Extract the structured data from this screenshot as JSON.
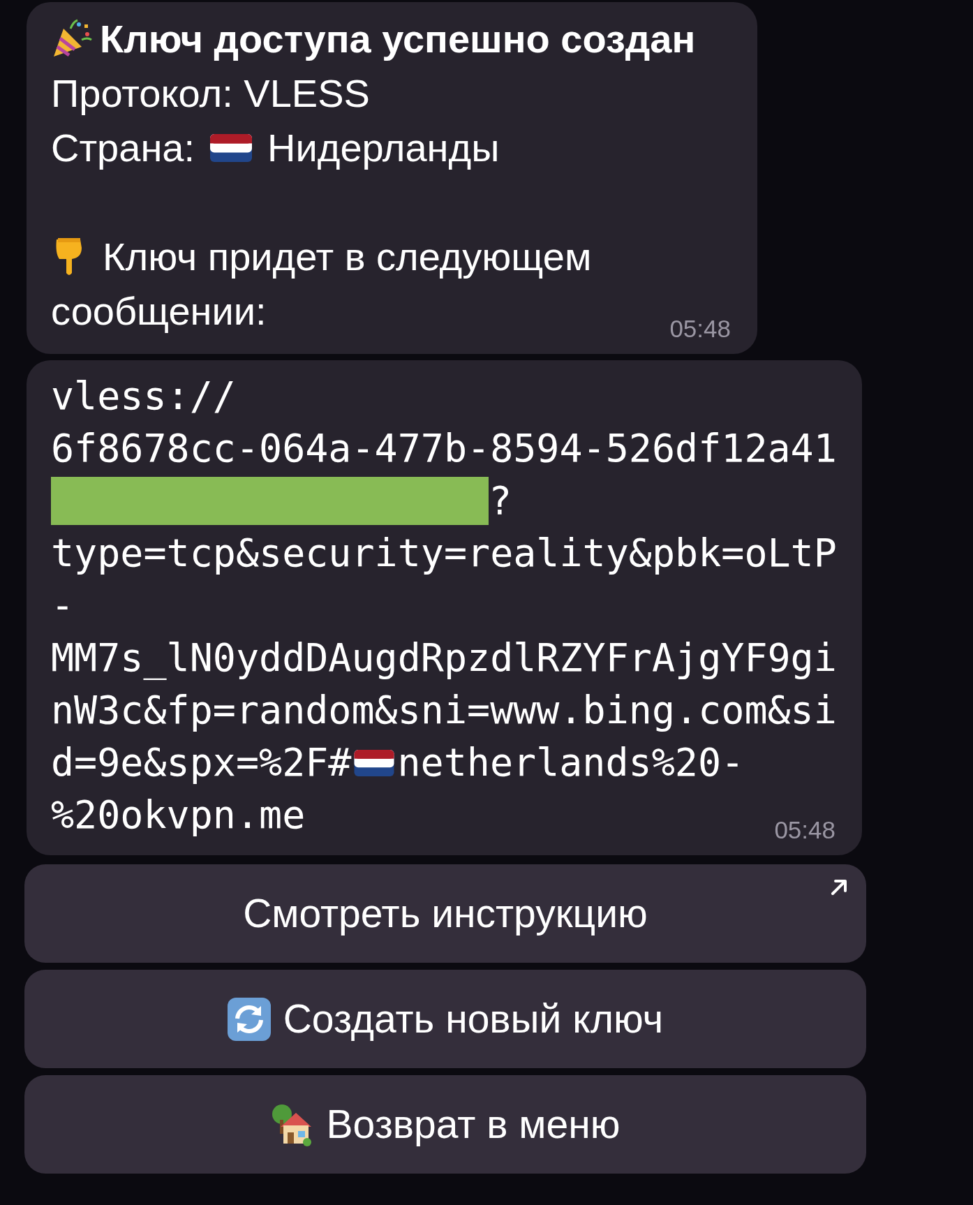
{
  "info_message": {
    "title": "Ключ доступа успешно создан",
    "protocol": "Протокол: VLESS",
    "country_label": "Страна:",
    "country": "Нидерланды",
    "note_lines": [
      "Ключ придет в следующем",
      "сообщении:"
    ],
    "time": "05:48"
  },
  "key_message": {
    "lines": [
      {
        "kind": "text",
        "text": "vless://"
      },
      {
        "kind": "text",
        "text": "6f8678cc-064a-477b-8594-526df12a41"
      },
      {
        "kind": "redacted",
        "text": "?"
      },
      {
        "kind": "text",
        "text": "type=tcp&security=reality&pbk=oLtP"
      },
      {
        "kind": "text",
        "text": "-"
      },
      {
        "kind": "text",
        "text": "MM7s_lN0yddDAugdRpzdlRZYFrAjgYF9gi"
      },
      {
        "kind": "text",
        "text": "nW3c&fp=random&sni=www.bing.com&si"
      },
      {
        "kind": "flag",
        "before": "d=9e&spx=%2F#",
        "after": "netherlands%20-"
      },
      {
        "kind": "text",
        "text": "%20okvpn.me"
      }
    ],
    "time": "05:48"
  },
  "buttons": [
    {
      "label": "Смотреть инструкцию",
      "kind": "plain",
      "external": true
    },
    {
      "label": "Создать новый ключ",
      "kind": "refresh",
      "external": false
    },
    {
      "label": "Возврат в меню",
      "kind": "home",
      "external": false
    }
  ]
}
